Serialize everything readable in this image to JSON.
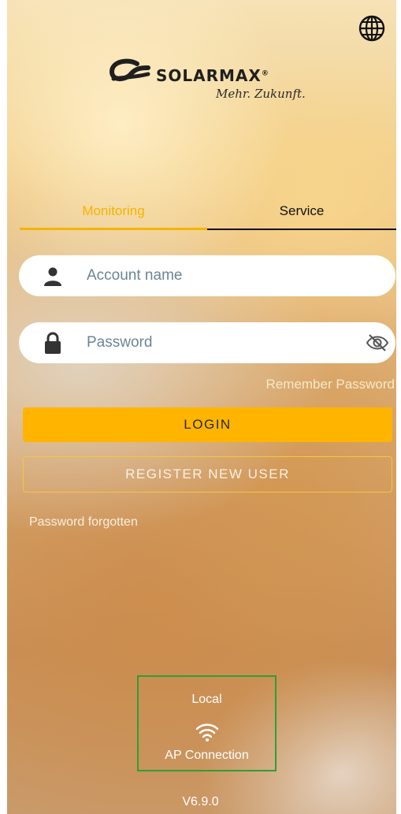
{
  "header": {
    "globe_icon": "globe-icon",
    "brand": "SOLARMAX",
    "registered_mark": "®",
    "tagline": "Mehr. Zukunft."
  },
  "tabs": [
    {
      "label": "Monitoring",
      "active": true
    },
    {
      "label": "Service",
      "active": false
    }
  ],
  "form": {
    "account_placeholder": "Account name",
    "account_value": "",
    "password_placeholder": "Password",
    "password_value": "",
    "remember_label": "Remember Password",
    "login_label": "LOGIN",
    "register_label": "REGISTER NEW USER",
    "forgot_label": "Password forgotten"
  },
  "local": {
    "label": "Local",
    "icon": "wifi-icon",
    "connection_label": "AP Connection"
  },
  "version": "V6.9.0",
  "colors": {
    "accent": "#FFB400",
    "tab_active": "#F4B400",
    "highlight_border": "#2E9E3A"
  }
}
